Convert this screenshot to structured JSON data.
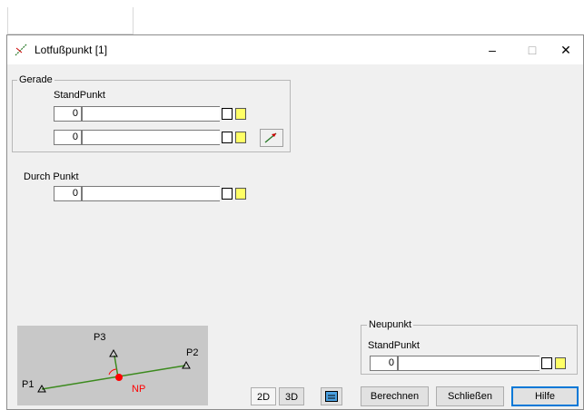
{
  "window": {
    "title": "Lotfußpunkt [1]",
    "minimize": "–",
    "maximize": "□",
    "close": "✕"
  },
  "gerade": {
    "label": "Gerade",
    "standpunkt_label": "StandPunkt",
    "row1": {
      "number": "0",
      "value": ""
    },
    "row2": {
      "number": "0",
      "value": ""
    }
  },
  "durch": {
    "label": "Durch Punkt",
    "number": "0",
    "value": ""
  },
  "neupunkt": {
    "label": "Neupunkt",
    "standpunkt_label": "StandPunkt",
    "number": "0",
    "value": ""
  },
  "diagram": {
    "p1": "P1",
    "p2": "P2",
    "p3": "P3",
    "np": "NP",
    "line_color": "#3c8a1e",
    "np_color": "#ff0000"
  },
  "buttons": {
    "view2d": "2D",
    "view3d": "3D",
    "berechnen": "Berechnen",
    "schliessen": "Schließen",
    "hilfe": "Hilfe"
  },
  "icons": {
    "title": "lotfuss-icon",
    "doc": "document-icon",
    "search": "search-icon",
    "pick": "pick-arrow-icon",
    "display": "display-icon"
  }
}
